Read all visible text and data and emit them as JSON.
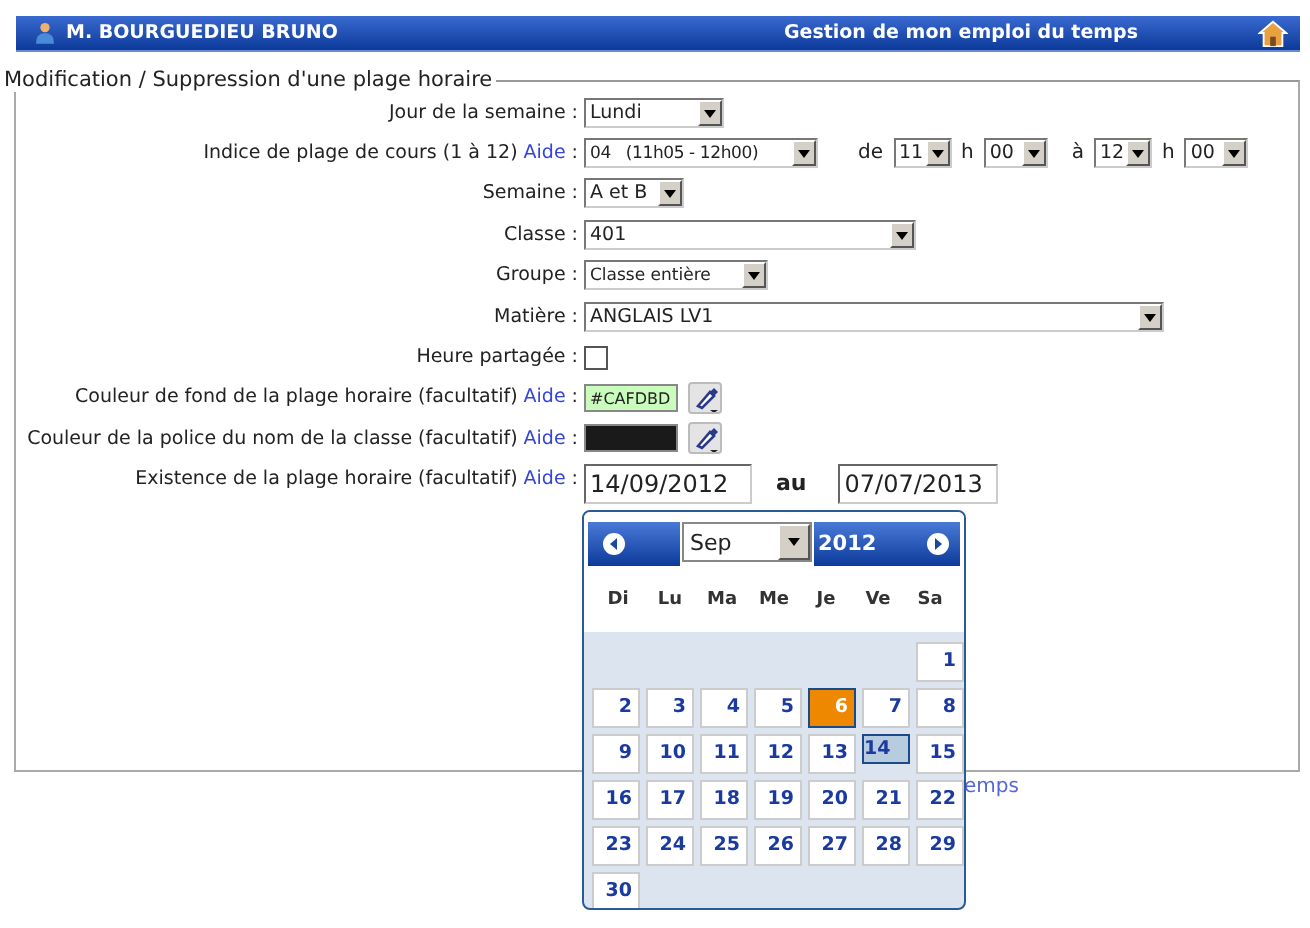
{
  "header": {
    "user": "M. BOURGUEDIEU BRUNO",
    "title": "Gestion de mon emploi du temps"
  },
  "form": {
    "legend": "Modification / Suppression d'une plage horaire",
    "rows": [
      {
        "kind": "select",
        "label": "Jour de la semaine",
        "colon": ":",
        "value": "Lundi"
      },
      {
        "kind": "time",
        "label": "Indice de plage de cours (1 à 12)",
        "help": "Aide",
        "colon": ":",
        "value": "04   (11h05 - 12h00)",
        "from_label": "de",
        "from_h": "11",
        "h1": "h",
        "from_m": "00",
        "to_label": "à",
        "to_h": "12",
        "h2": "h",
        "to_m": "00"
      },
      {
        "kind": "select",
        "label": "Semaine",
        "colon": ":",
        "value": "A et B"
      },
      {
        "kind": "select",
        "label": "Classe",
        "colon": ":",
        "value": "401"
      },
      {
        "kind": "select",
        "label": "Groupe",
        "colon": ":",
        "value": "Classe entière"
      },
      {
        "kind": "select",
        "label": "Matière",
        "colon": ":",
        "value": "ANGLAIS LV1"
      },
      {
        "kind": "checkbox",
        "label": "Heure partagée",
        "colon": ":",
        "checked": false
      },
      {
        "kind": "color",
        "label": "Couleur de fond de la plage horaire (facultatif)",
        "help": "Aide",
        "colon": ":",
        "value": "#CAFDBD",
        "color": "#cafdbd"
      },
      {
        "kind": "color",
        "label": "Couleur de la police du nom de la classe (facultatif)",
        "help": "Aide",
        "colon": ":",
        "color": "#1a1a1a"
      },
      {
        "kind": "daterange",
        "label": "Existence de la plage horaire (facultatif)",
        "help": "Aide",
        "colon": ":",
        "start": "14/09/2012",
        "sep": "au",
        "end": "07/07/2013"
      }
    ],
    "link_fragment": "emps"
  },
  "calendar": {
    "month": "Sep",
    "year": "2012",
    "weekdays": [
      "Di",
      "Lu",
      "Ma",
      "Me",
      "Je",
      "Ve",
      "Sa"
    ],
    "days": [
      {
        "n": "1",
        "selected": false,
        "hover": false
      },
      {
        "n": "2",
        "selected": false,
        "hover": false
      },
      {
        "n": "3",
        "selected": false,
        "hover": false
      },
      {
        "n": "4",
        "selected": false,
        "hover": false
      },
      {
        "n": "5",
        "selected": false,
        "hover": false
      },
      {
        "n": "6",
        "selected": false,
        "hover": true
      },
      {
        "n": "7",
        "selected": false,
        "hover": false
      },
      {
        "n": "8",
        "selected": false,
        "hover": false
      },
      {
        "n": "9",
        "selected": false,
        "hover": false
      },
      {
        "n": "10",
        "selected": false,
        "hover": false
      },
      {
        "n": "11",
        "selected": false,
        "hover": false
      },
      {
        "n": "12",
        "selected": false,
        "hover": false
      },
      {
        "n": "13",
        "selected": false,
        "hover": false
      },
      {
        "n": "14",
        "selected": true,
        "hover": false
      },
      {
        "n": "15",
        "selected": false,
        "hover": false
      },
      {
        "n": "16",
        "selected": false,
        "hover": false
      },
      {
        "n": "17",
        "selected": false,
        "hover": false
      },
      {
        "n": "18",
        "selected": false,
        "hover": false
      },
      {
        "n": "19",
        "selected": false,
        "hover": false
      },
      {
        "n": "20",
        "selected": false,
        "hover": false
      },
      {
        "n": "21",
        "selected": false,
        "hover": false
      },
      {
        "n": "22",
        "selected": false,
        "hover": false
      },
      {
        "n": "23",
        "selected": false,
        "hover": false
      },
      {
        "n": "24",
        "selected": false,
        "hover": false
      },
      {
        "n": "25",
        "selected": false,
        "hover": false
      },
      {
        "n": "26",
        "selected": false,
        "hover": false
      },
      {
        "n": "27",
        "selected": false,
        "hover": false
      },
      {
        "n": "28",
        "selected": false,
        "hover": false
      },
      {
        "n": "29",
        "selected": false,
        "hover": false
      },
      {
        "n": "30",
        "selected": false,
        "hover": false
      }
    ]
  }
}
